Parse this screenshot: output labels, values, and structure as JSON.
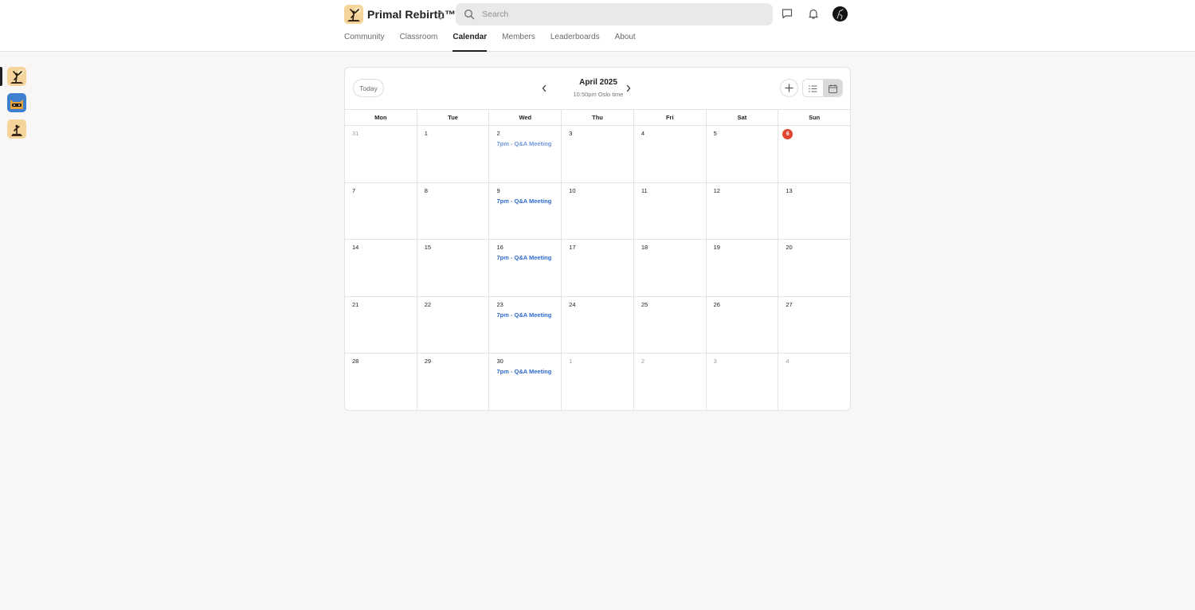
{
  "header": {
    "group_name": "Primal Rebirth™",
    "search_placeholder": "Search"
  },
  "nav": {
    "tabs": [
      {
        "label": "Community",
        "active": false
      },
      {
        "label": "Classroom",
        "active": false
      },
      {
        "label": "Calendar",
        "active": true
      },
      {
        "label": "Members",
        "active": false
      },
      {
        "label": "Leaderboards",
        "active": false
      },
      {
        "label": "About",
        "active": false
      }
    ]
  },
  "rail": {
    "groups": [
      "primal-rebirth-group",
      "cat-mascot-group",
      "silhouette-group"
    ]
  },
  "calendar": {
    "today_label": "Today",
    "month_label": "April 2025",
    "timezone_label": "10:50pm Oslo time",
    "weekdays": [
      "Mon",
      "Tue",
      "Wed",
      "Thu",
      "Fri",
      "Sat",
      "Sun"
    ],
    "weeks": [
      [
        {
          "day": "31",
          "out": true
        },
        {
          "day": "1"
        },
        {
          "day": "2",
          "event": "7pm - Q&A Meeting",
          "past": true
        },
        {
          "day": "3"
        },
        {
          "day": "4"
        },
        {
          "day": "5"
        },
        {
          "day": "6",
          "today": true
        }
      ],
      [
        {
          "day": "7"
        },
        {
          "day": "8"
        },
        {
          "day": "9",
          "event": "7pm - Q&A Meeting"
        },
        {
          "day": "10"
        },
        {
          "day": "11"
        },
        {
          "day": "12"
        },
        {
          "day": "13"
        }
      ],
      [
        {
          "day": "14"
        },
        {
          "day": "15"
        },
        {
          "day": "16",
          "event": "7pm - Q&A Meeting"
        },
        {
          "day": "17"
        },
        {
          "day": "18"
        },
        {
          "day": "19"
        },
        {
          "day": "20"
        }
      ],
      [
        {
          "day": "21"
        },
        {
          "day": "22"
        },
        {
          "day": "23",
          "event": "7pm - Q&A Meeting"
        },
        {
          "day": "24"
        },
        {
          "day": "25"
        },
        {
          "day": "26"
        },
        {
          "day": "27"
        }
      ],
      [
        {
          "day": "28"
        },
        {
          "day": "29"
        },
        {
          "day": "30",
          "event": "7pm - Q&A Meeting"
        },
        {
          "day": "1",
          "out": true
        },
        {
          "day": "2",
          "out": true
        },
        {
          "day": "3",
          "out": true
        },
        {
          "day": "4",
          "out": true
        }
      ]
    ]
  },
  "colors": {
    "accent_today": "#e0452e",
    "event_blue": "#2f6ad0",
    "event_past_blue": "#6f97e0"
  }
}
